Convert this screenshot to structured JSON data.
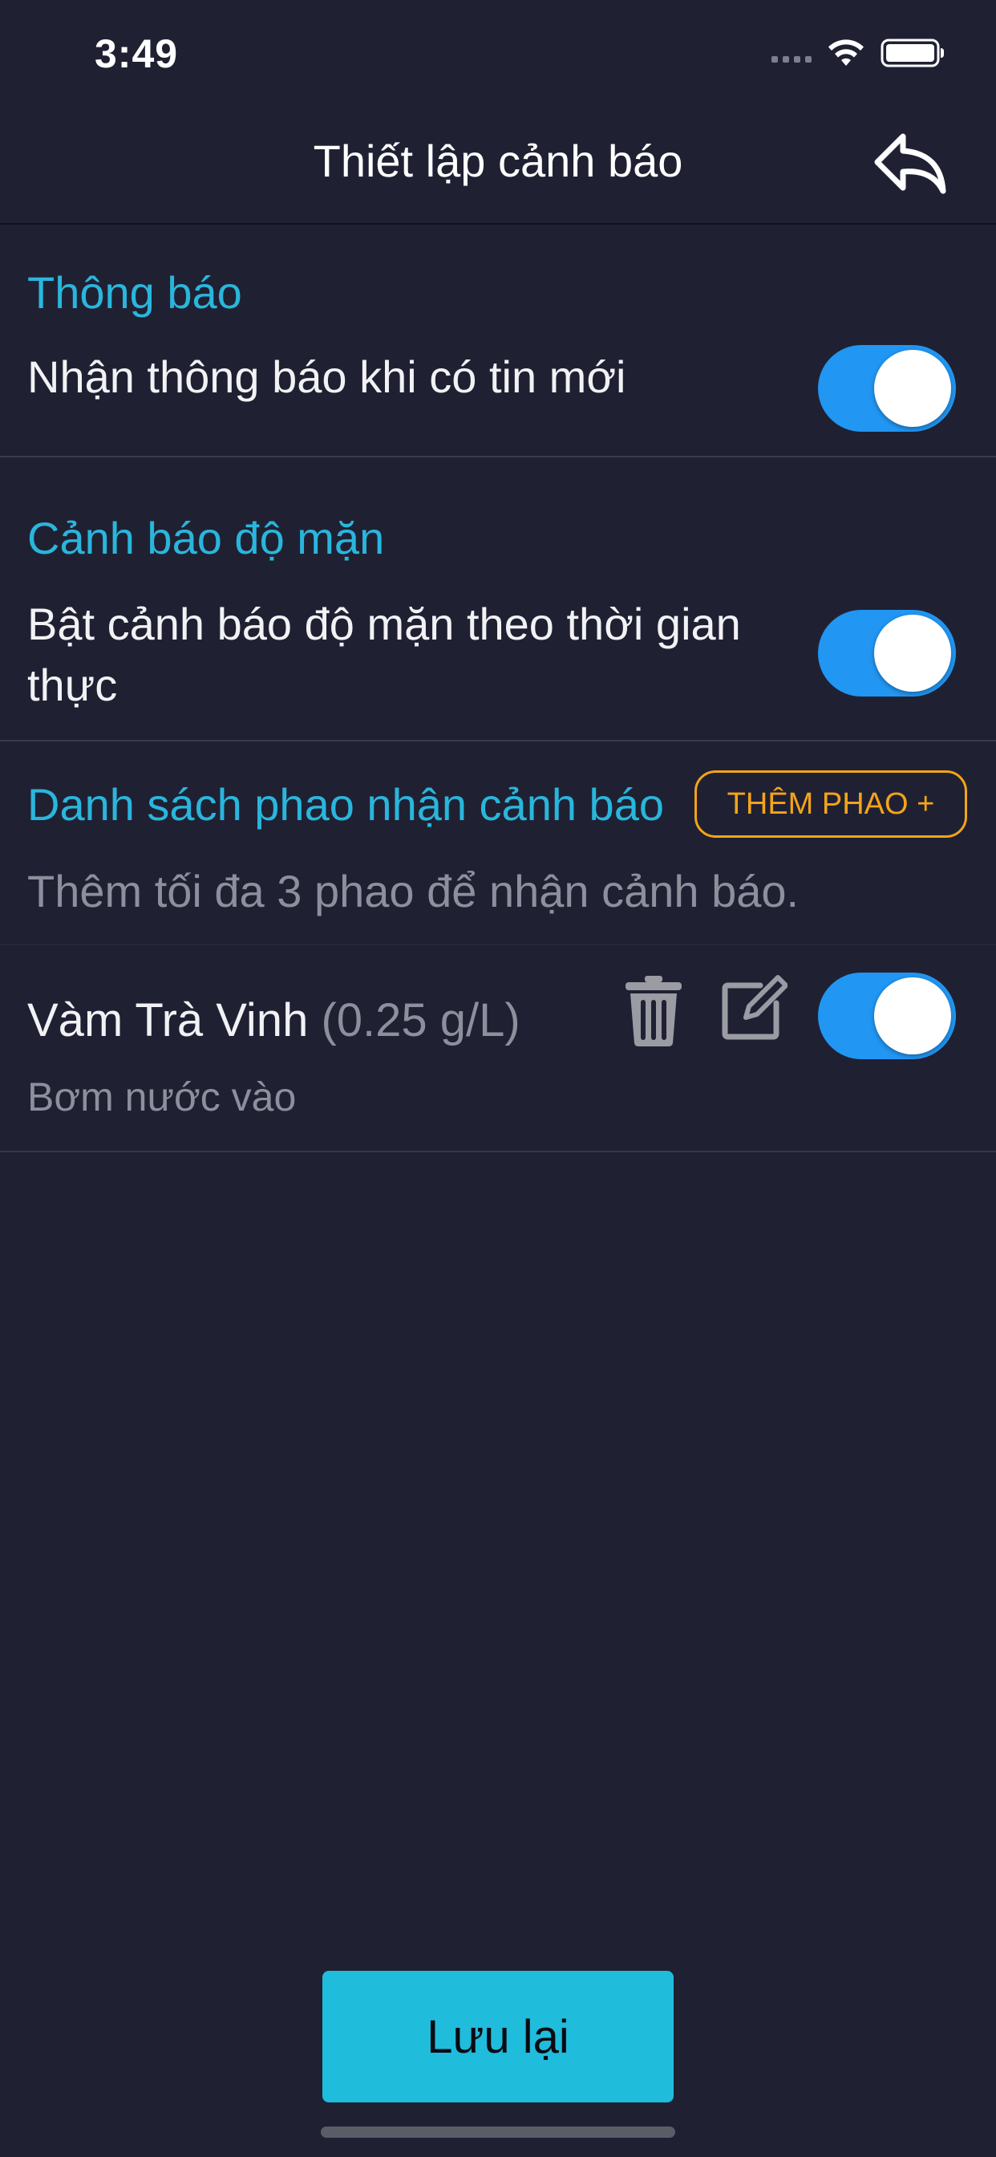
{
  "status_bar": {
    "time": "3:49"
  },
  "header": {
    "title": "Thiết lập cảnh báo"
  },
  "notifications": {
    "section_title": "Thông báo",
    "label": "Nhận thông báo khi có tin mới",
    "enabled": true
  },
  "salinity": {
    "section_title": "Cảnh báo độ mặn",
    "label": "Bật cảnh báo độ mặn theo thời gian thực",
    "enabled": true
  },
  "buoy_list": {
    "section_title": "Danh sách phao nhận cảnh báo",
    "add_label": "THÊM PHAO +",
    "hint": "Thêm tối đa 3 phao để nhận cảnh báo.",
    "items": [
      {
        "name": "Vàm Trà Vinh",
        "value": "(0.25 g/L)",
        "action": "Bơm nước vào",
        "enabled": true
      }
    ]
  },
  "footer": {
    "save_label": "Lưu lại"
  },
  "colors": {
    "background": "#1f2133",
    "accent_cyan": "#2ab6dc",
    "toggle_blue": "#2196f3",
    "add_orange": "#f5a418",
    "save_button": "#1fbcdc"
  },
  "icons": {
    "back": "reply-arrow-icon",
    "wifi": "wifi-icon",
    "battery": "battery-icon",
    "delete": "trash-icon",
    "edit": "edit-icon"
  }
}
